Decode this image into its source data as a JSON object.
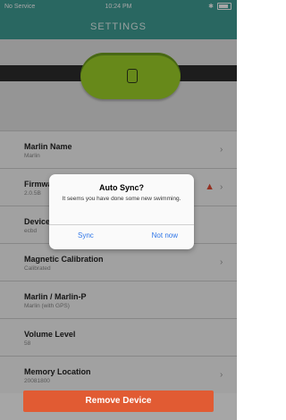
{
  "status": {
    "carrier": "No Service",
    "wifi": "wifi",
    "time": "10:24 PM",
    "right_icons": "bluetooth",
    "battery": "battery"
  },
  "header": {
    "title": "SETTINGS"
  },
  "device": {
    "icon": "device-indicator-icon"
  },
  "rows": [
    {
      "title": "Marlin Name",
      "sub": "Marlin",
      "chev": "›"
    },
    {
      "title": "Firmware",
      "sub": "2.0.5B",
      "chev": "›",
      "warning": "▲"
    },
    {
      "title": "Device",
      "sub": "ecbd",
      "chev": ""
    },
    {
      "title": "Magnetic Calibration",
      "sub": "Calibrated",
      "chev": "›"
    },
    {
      "title": "Marlin / Marlin-P",
      "sub": "Marlin (with GPS)",
      "chev": ""
    },
    {
      "title": "Volume Level",
      "sub": "58",
      "chev": ""
    },
    {
      "title": "Memory Location",
      "sub": "20081800",
      "chev": "›"
    }
  ],
  "dialog": {
    "title": "Auto Sync?",
    "message": "It seems you have done some new swimming.",
    "sync": "Sync",
    "later": "Not now"
  },
  "footer": {
    "remove": "Remove Device"
  },
  "colors": {
    "header_bg": "#3f9e96",
    "remove_bg": "#e15b33",
    "accent_blue": "#2f76e8",
    "warning": "#e44a33",
    "device": "#9ed329"
  }
}
